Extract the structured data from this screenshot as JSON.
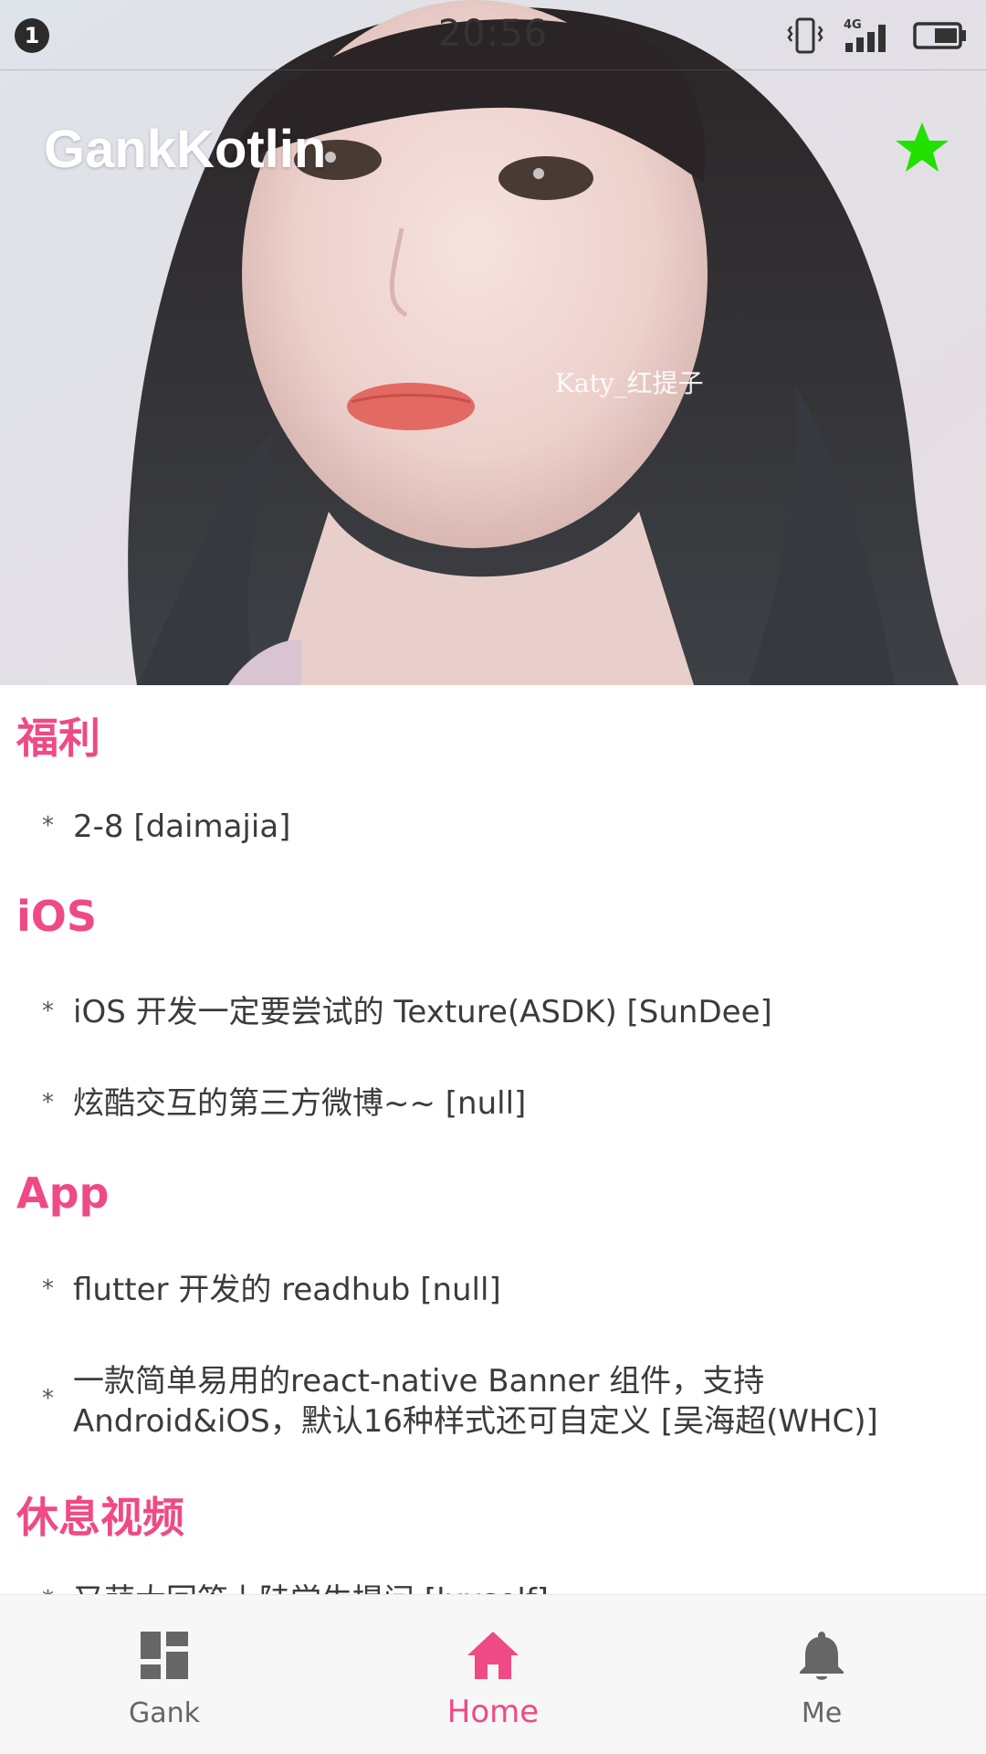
{
  "status_bar": {
    "notification_count": "1",
    "time": "20:56",
    "network": "4G"
  },
  "header": {
    "title": "GankKotlin",
    "watermark": "Katy_红提子",
    "star_color": "#22e000",
    "star_icon": "star-icon"
  },
  "sections": [
    {
      "title": "福利",
      "items": [
        {
          "text": "2-8  [daimajia]"
        }
      ]
    },
    {
      "title": "iOS",
      "items": [
        {
          "text": "iOS 开发一定要尝试的 Texture(ASDK)  [SunDee]"
        },
        {
          "text": "炫酷交互的第三方微博~~  [null]"
        }
      ]
    },
    {
      "title": "App",
      "items": [
        {
          "text": "flutter 开发的 readhub  [null]"
        },
        {
          "line1": "一款简单易用的react-native Banner 组件，支持",
          "line2": "Android&iOS，默认16种样式还可自定义  [吴海超(WHC)]"
        }
      ]
    },
    {
      "title": "休息视频",
      "items": [
        {
          "text": "又萌大回答上陆学生提问  [lxxself]"
        }
      ]
    }
  ],
  "bottom_nav": {
    "items": [
      {
        "label": "Gank",
        "icon": "dashboard-icon"
      },
      {
        "label": "Home",
        "icon": "home-icon"
      },
      {
        "label": "Me",
        "icon": "bell-icon"
      }
    ],
    "active_index": 1,
    "active_color": "#ef4a85",
    "inactive_color": "#666666"
  },
  "colors": {
    "accent": "#ef4a85",
    "text": "#3b3b3b"
  }
}
